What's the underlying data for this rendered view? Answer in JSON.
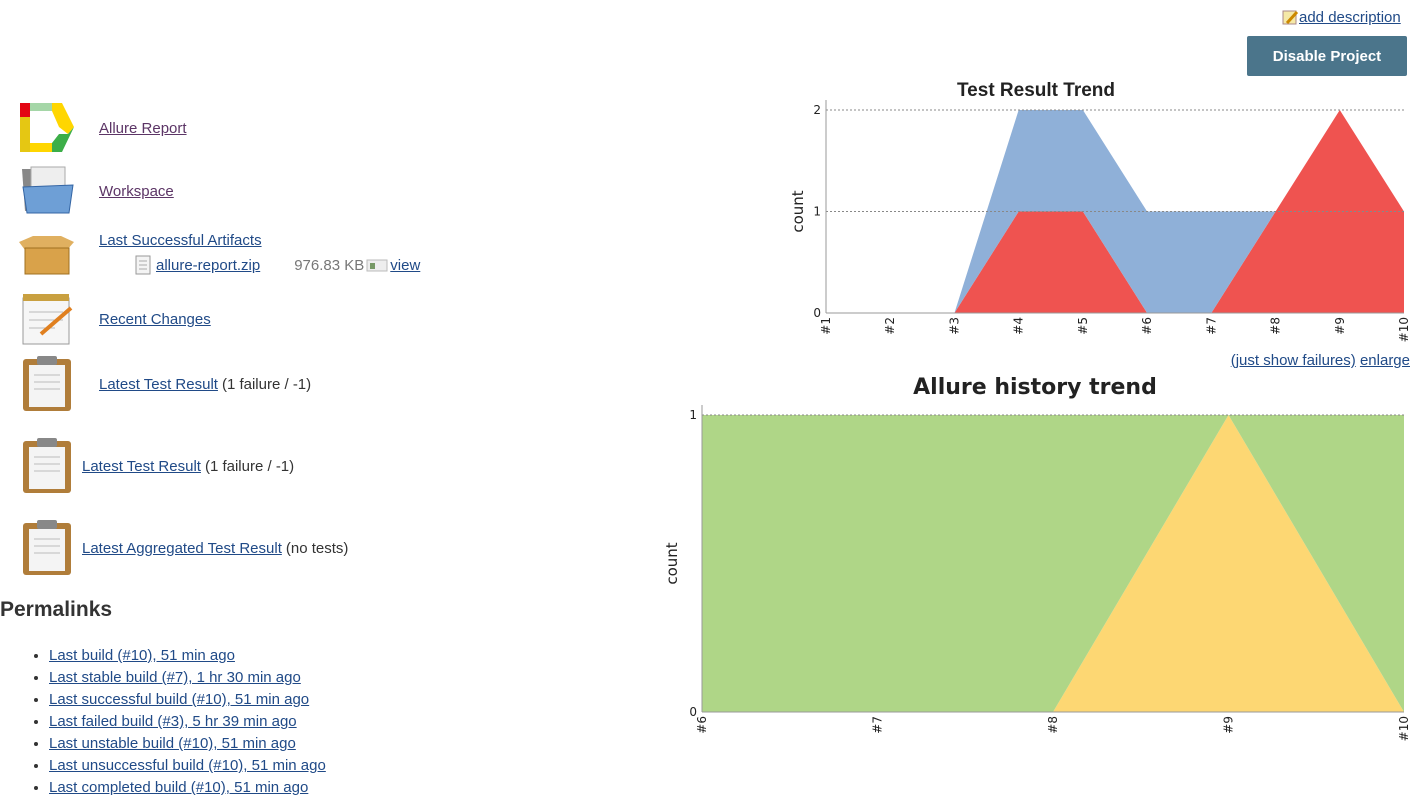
{
  "header": {
    "add_description": "add description",
    "disable_button": "Disable Project"
  },
  "tasks": [
    {
      "label": "Allure Report",
      "icon": "allure-logo-icon"
    },
    {
      "label": "Workspace",
      "icon": "folder-icon"
    },
    {
      "label": "Last Successful Artifacts",
      "icon": "package-icon"
    },
    {
      "label": "Recent Changes",
      "icon": "notepad-icon"
    },
    {
      "label": "Latest Test Result",
      "suffix": "(1 failure / -1)",
      "icon": "clipboard-icon"
    },
    {
      "label": "Latest Test Result",
      "suffix": "(1 failure / -1)",
      "icon": "clipboard-icon"
    },
    {
      "label": "Latest Aggregated Test Result",
      "suffix": "(no tests)",
      "icon": "clipboard-icon"
    }
  ],
  "artifact": {
    "name": "allure-report.zip",
    "size": "976.83 KB",
    "view": "view"
  },
  "permalinks": {
    "title": "Permalinks",
    "items": [
      "Last build (#10), 51 min ago",
      "Last stable build (#7), 1 hr 30 min ago",
      "Last successful build (#10), 51 min ago",
      "Last failed build (#3), 5 hr 39 min ago",
      "Last unstable build (#10), 51 min ago",
      "Last unsuccessful build (#10), 51 min ago",
      "Last completed build (#10), 51 min ago"
    ]
  },
  "trend_links": {
    "just_failures": "(just show failures)",
    "enlarge": "enlarge"
  },
  "chart_data": [
    {
      "type": "area",
      "stacked": true,
      "title": "Test Result Trend",
      "ylabel": "count",
      "categories": [
        "#1",
        "#2",
        "#3",
        "#4",
        "#5",
        "#6",
        "#7",
        "#8",
        "#9",
        "#10"
      ],
      "ylim": [
        0,
        2
      ],
      "yticks": [
        0,
        1,
        2
      ],
      "grid": true,
      "series": [
        {
          "values": [
            0,
            0,
            0,
            1,
            1,
            0,
            0,
            1,
            2,
            1
          ],
          "color": "#ef5350"
        },
        {
          "values": [
            0,
            0,
            0,
            1,
            1,
            1,
            1,
            0,
            0,
            0
          ],
          "color": "#8fb0d8"
        }
      ]
    },
    {
      "type": "area",
      "stacked": true,
      "title": "Allure history trend",
      "ylabel": "count",
      "categories": [
        "#6",
        "#7",
        "#8",
        "#9",
        "#10"
      ],
      "ylim": [
        0,
        1
      ],
      "yticks": [
        0,
        1
      ],
      "grid": true,
      "series": [
        {
          "values": [
            0,
            0,
            0,
            1,
            0
          ],
          "color": "#fdd773"
        },
        {
          "values": [
            1,
            1,
            1,
            0,
            1
          ],
          "color": "#afd687"
        }
      ]
    }
  ]
}
